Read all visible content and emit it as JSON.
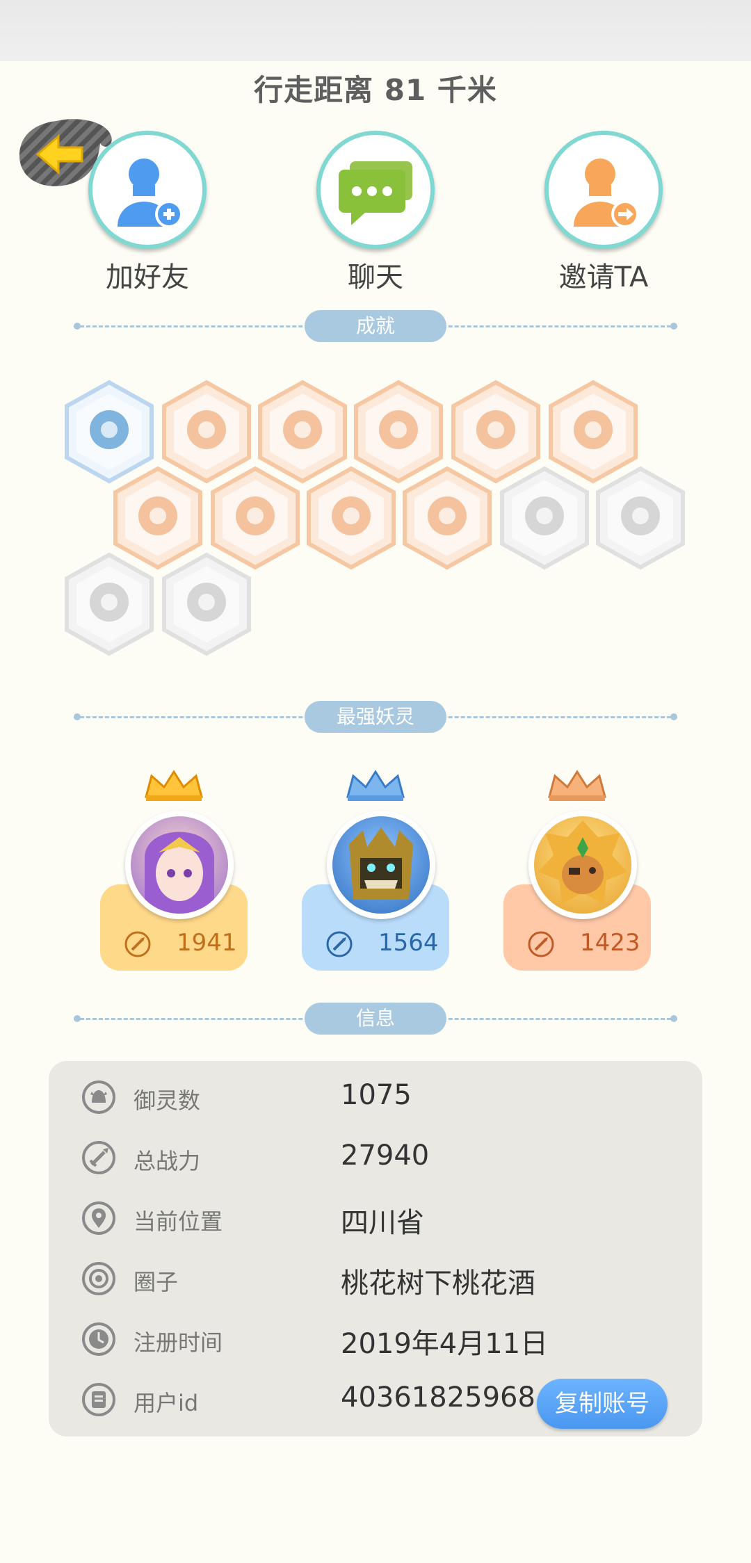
{
  "header": {
    "walk_distance": "行走距离 81 千米"
  },
  "actions": [
    {
      "label": "加好友",
      "icon": "add-friend-icon"
    },
    {
      "label": "聊天",
      "icon": "chat-icon"
    },
    {
      "label": "邀请TA",
      "icon": "invite-icon"
    }
  ],
  "sections": {
    "achievements": "成就",
    "strongest": "最强妖灵",
    "info": "信息"
  },
  "strongest_spirits": [
    {
      "power": "1941",
      "theme": "#ffd98a",
      "text_color": "#c0701a"
    },
    {
      "power": "1564",
      "theme": "#b9dcfb",
      "text_color": "#2a67a8"
    },
    {
      "power": "1423",
      "theme": "#ffc9a8",
      "text_color": "#c25a27"
    }
  ],
  "info": {
    "rows": [
      {
        "key": "御灵数",
        "value": "1075",
        "icon": "spirit-count-icon"
      },
      {
        "key": "总战力",
        "value": "27940",
        "icon": "sword-icon"
      },
      {
        "key": "当前位置",
        "value": "四川省",
        "icon": "location-pin-icon"
      },
      {
        "key": "圈子",
        "value": "桃花树下桃花酒",
        "icon": "circle-target-icon"
      },
      {
        "key": "注册时间",
        "value": "2019年4月11日",
        "icon": "clock-icon"
      },
      {
        "key": "用户id",
        "value": "40361825968",
        "icon": "id-card-icon"
      }
    ],
    "copy_button": "复制账号"
  },
  "colors": {
    "accent": "#4a97f0",
    "divider": "#a9c9e0",
    "hex_orange": "#f3b88f",
    "hex_gray": "#d8d8d8"
  }
}
